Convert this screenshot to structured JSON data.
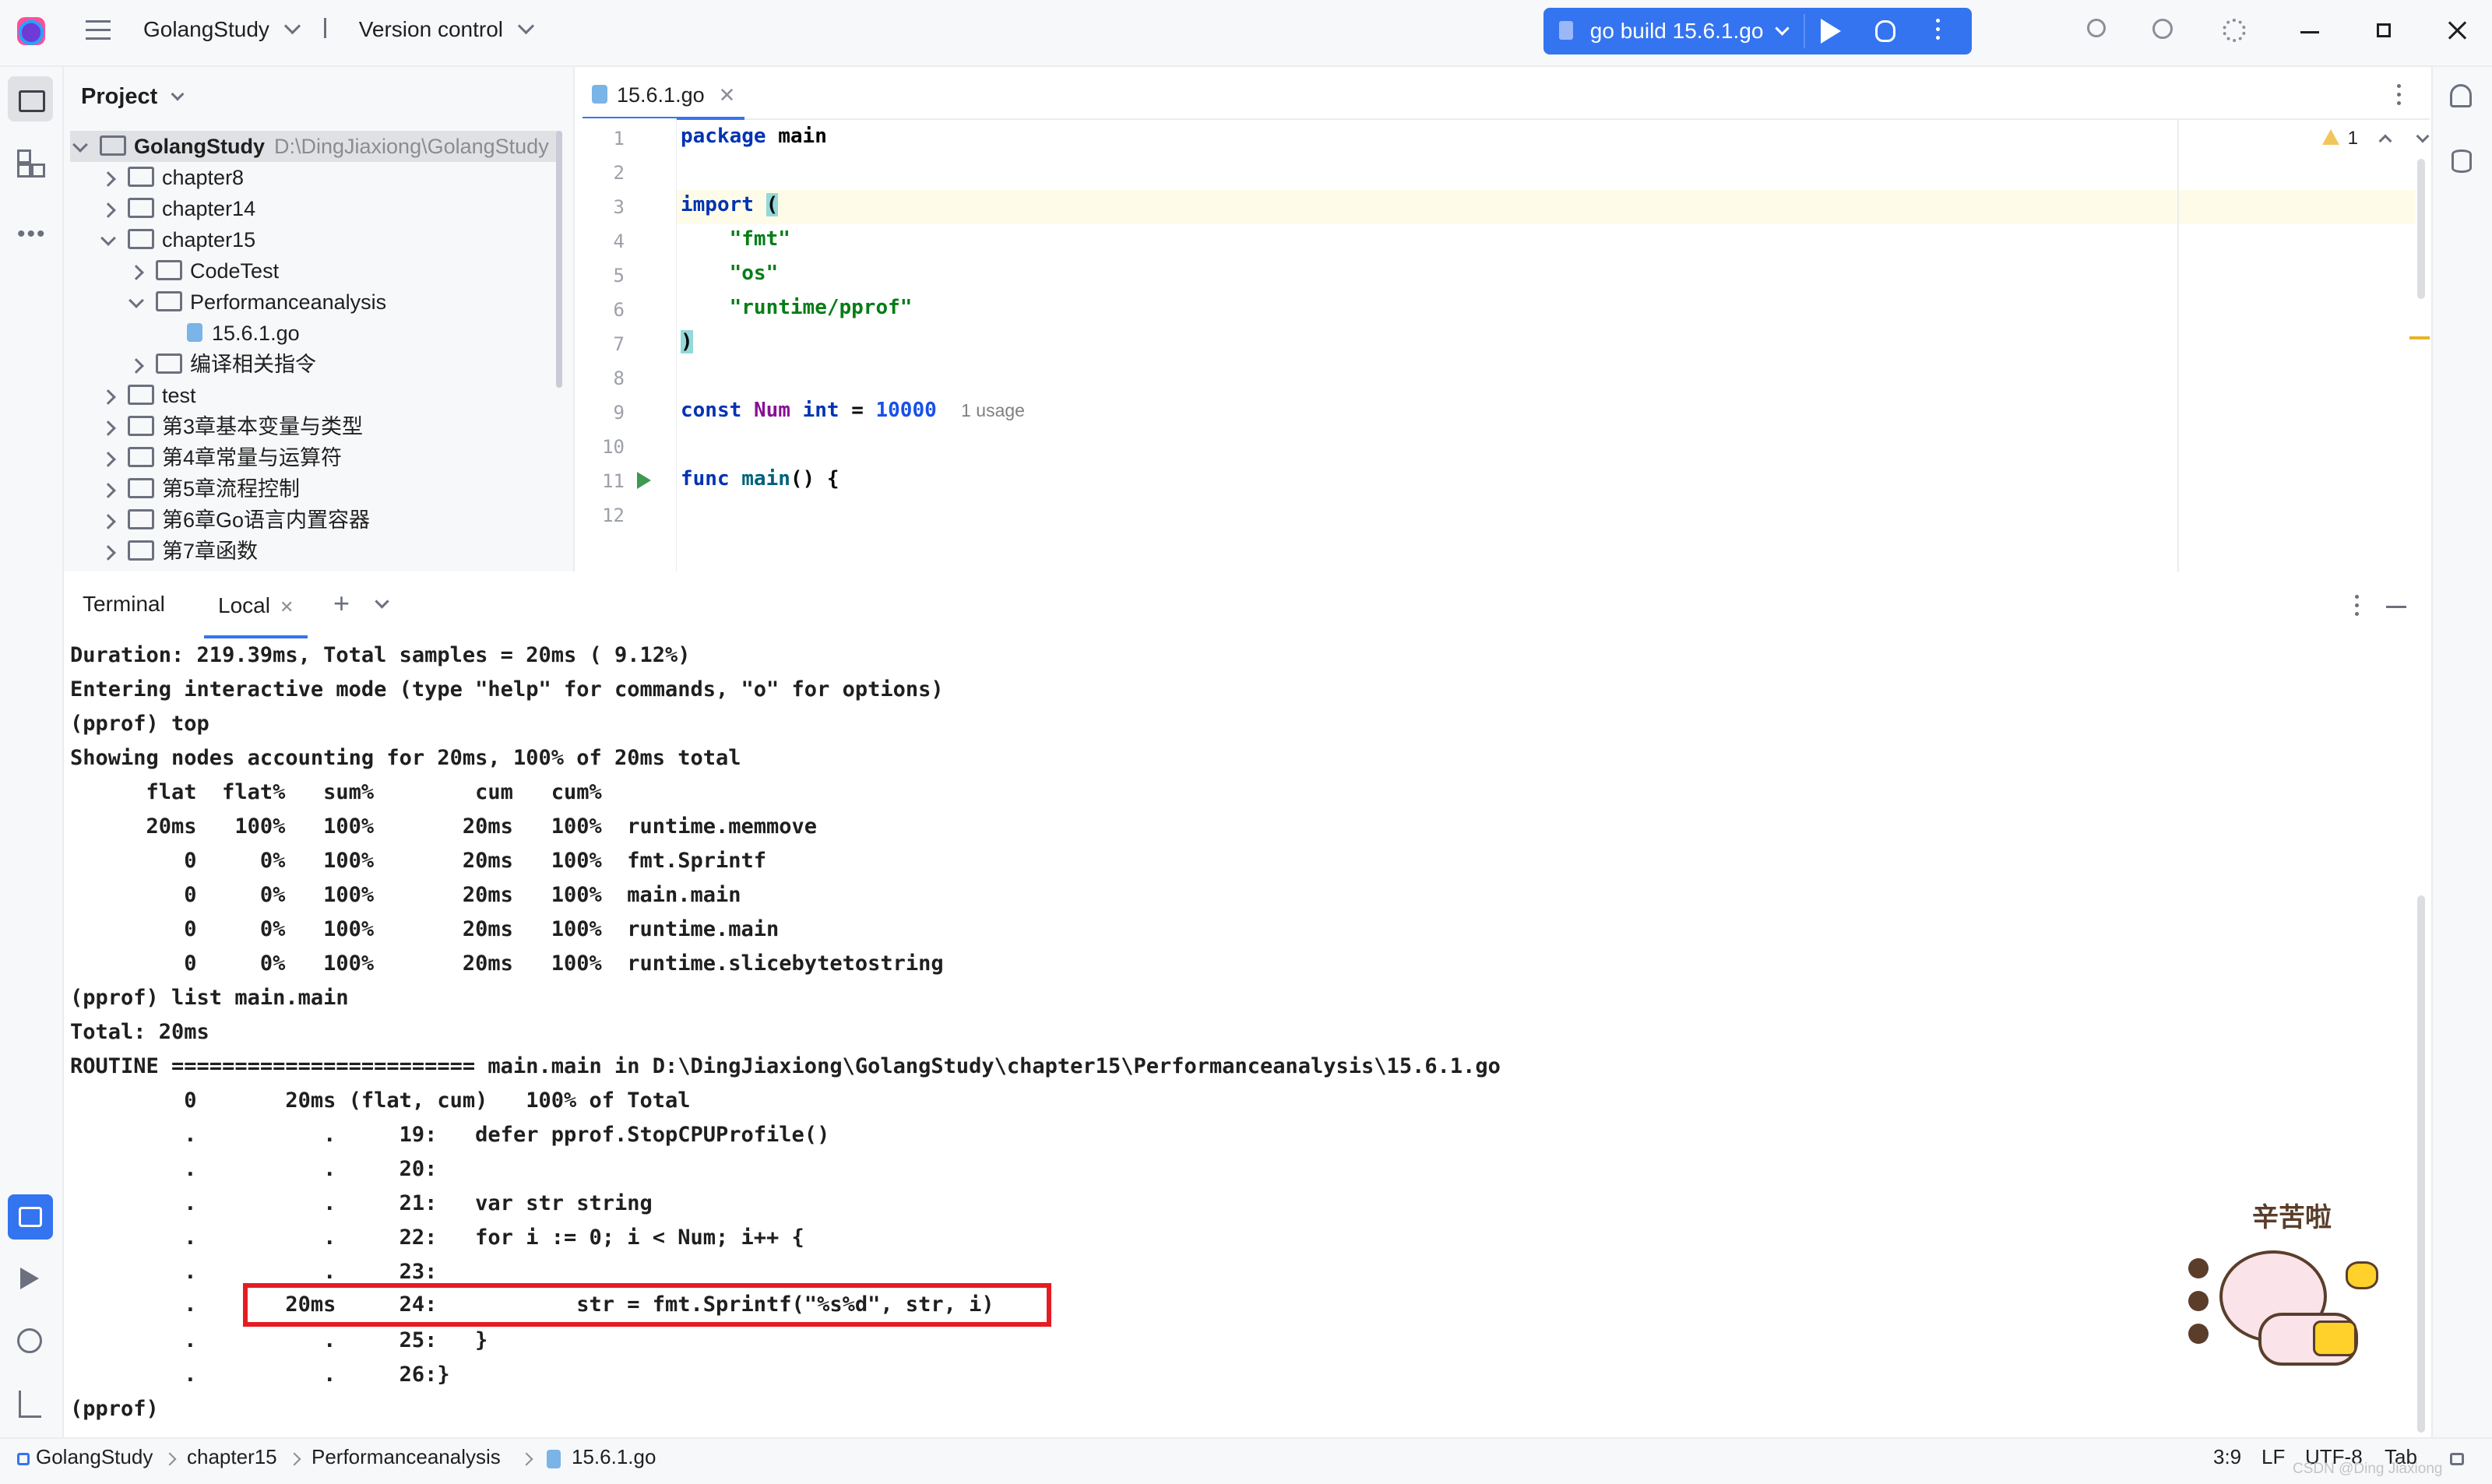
{
  "titlebar": {
    "project": "GolangStudy",
    "vcs": "Version control",
    "run_config": "go build 15.6.1.go"
  },
  "project_panel": {
    "title": "Project",
    "items": [
      {
        "label": "GolangStudy",
        "hint": "D:\\DingJiaxiong\\GolangStudy"
      },
      {
        "label": "chapter8"
      },
      {
        "label": "chapter14"
      },
      {
        "label": "chapter15"
      },
      {
        "label": "CodeTest"
      },
      {
        "label": "Performanceanalysis"
      },
      {
        "label": "15.6.1.go"
      },
      {
        "label": "编译相关指令"
      },
      {
        "label": "test"
      },
      {
        "label": "第3章基本变量与类型"
      },
      {
        "label": "第4章常量与运算符"
      },
      {
        "label": "第5章流程控制"
      },
      {
        "label": "第6章Go语言内置容器"
      },
      {
        "label": "第7章函数"
      }
    ]
  },
  "editor": {
    "tab": "15.6.1.go",
    "warning_count": "1",
    "line_numbers": [
      "1",
      "2",
      "3",
      "4",
      "5",
      "6",
      "7",
      "8",
      "9",
      "10",
      "11",
      "12"
    ],
    "code": {
      "l1_kw": "package",
      "l1_name": "main",
      "l3_kw": "import",
      "l3_paren": "(",
      "l4": "\"fmt\"",
      "l5": "\"os\"",
      "l6": "\"runtime/pprof\"",
      "l7": ")",
      "l9_kw": "const",
      "l9_name": "Num",
      "l9_type": "int",
      "l9_eq": "=",
      "l9_val": "10000",
      "l9_hint": "1 usage",
      "l11_kw": "func",
      "l11_name": "main",
      "l11_rest": "() {"
    }
  },
  "terminal": {
    "title": "Terminal",
    "tab": "Local",
    "lines": [
      "Duration: 219.39ms, Total samples = 20ms ( 9.12%)",
      "Entering interactive mode (type \"help\" for commands, \"o\" for options)",
      "(pprof) top",
      "Showing nodes accounting for 20ms, 100% of 20ms total",
      "      flat  flat%   sum%        cum   cum%",
      "      20ms   100%   100%       20ms   100%  runtime.memmove",
      "         0     0%   100%       20ms   100%  fmt.Sprintf",
      "         0     0%   100%       20ms   100%  main.main",
      "         0     0%   100%       20ms   100%  runtime.main",
      "         0     0%   100%       20ms   100%  runtime.slicebytetostring",
      "(pprof) list main.main",
      "Total: 20ms",
      "ROUTINE ======================== main.main in D:\\DingJiaxiong\\GolangStudy\\chapter15\\Performanceanalysis\\15.6.1.go",
      "         0       20ms (flat, cum)   100% of Total",
      "         .          .     19:   defer pprof.StopCPUProfile()",
      "         .          .     20:",
      "         .          .     21:   var str string",
      "         .          .     22:   for i := 0; i < Num; i++ {",
      "         .          .     23:",
      "         .       20ms     24:           str = fmt.Sprintf(\"%s%d\", str, i)",
      "         .          .     25:   }",
      "         .          .     26:}",
      "(pprof)"
    ],
    "sticker_text": "辛苦啦"
  },
  "statusbar": {
    "crumbs": [
      "GolangStudy",
      "chapter15",
      "Performanceanalysis",
      "15.6.1.go"
    ],
    "position": "3:9",
    "line_sep": "LF",
    "encoding": "UTF-8",
    "indent": "Tab",
    "watermark": "CSDN @Ding Jiaxiong"
  }
}
